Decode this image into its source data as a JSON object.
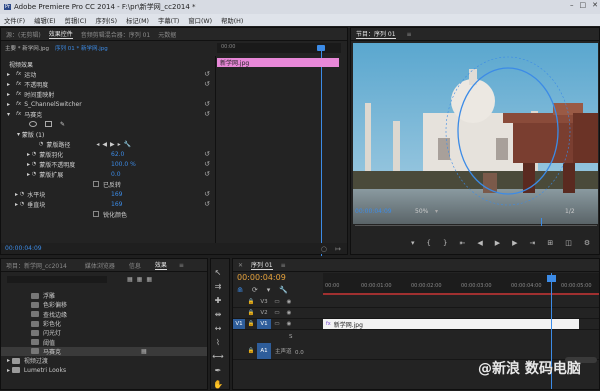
{
  "window": {
    "title": "Adobe Premiere Pro CC 2014 - F:\\pr\\新学网_cc2014 *",
    "logo_text": "Pr"
  },
  "menu": [
    "文件(F)",
    "编辑(E)",
    "剪辑(C)",
    "序列(S)",
    "标记(M)",
    "字幕(T)",
    "窗口(W)",
    "帮助(H)"
  ],
  "effect_controls": {
    "tabs": [
      "源：(无剪辑)",
      "效果控件",
      "音频剪辑混合器：序列 01",
      "元数据"
    ],
    "breadcrumb_master": "主要 * 新学网.jpg",
    "breadcrumb_seq": "序列 01 * 新学网.jpg",
    "section": "视频效果",
    "effects": [
      "运动",
      "不透明度",
      "时间重映射",
      "S_ChannelSwitcher",
      "马赛克"
    ],
    "mask_label": "蒙版 (1)",
    "mask_props": [
      {
        "name": "蒙版路径"
      },
      {
        "name": "蒙版羽化",
        "value": "62.0"
      },
      {
        "name": "蒙版不透明度",
        "value": "100.0 %"
      },
      {
        "name": "蒙版扩展",
        "value": "0.0"
      }
    ],
    "inverted_label": "已反转",
    "props": [
      {
        "name": "水平块",
        "value": "169"
      },
      {
        "name": "垂直块",
        "value": "169"
      }
    ],
    "sharp_label": "锐化颜色",
    "timecode": "00:00:04:09",
    "ruler_start": "00:00",
    "clip": "新学网.jpg"
  },
  "program": {
    "title": "节目：序列 01",
    "timecode": "00:00:04:09",
    "zoom": "50%",
    "fraction": "1/2"
  },
  "project": {
    "tabs": [
      "项目：新学网_cc2014",
      "媒体浏览器",
      "信息",
      "效果"
    ],
    "items": [
      "浮雕",
      "色彩偏移",
      "查找边缘",
      "彩色化",
      "闪光灯",
      "阈值",
      "马赛克"
    ],
    "folders": [
      "视频过渡",
      "Lumetri Looks"
    ]
  },
  "timeline": {
    "tab": "序列 01",
    "timecode": "00:00:04:09",
    "ruler": [
      "00:00",
      "00:00:01:00",
      "00:00:02:00",
      "00:00:03:00",
      "00:00:04:00",
      "00:00:05:00"
    ],
    "tracks": [
      {
        "src": "",
        "name": "V3"
      },
      {
        "src": "",
        "name": "V2"
      },
      {
        "src": "V1",
        "name": "V1"
      },
      {
        "src": "",
        "name": "A1"
      }
    ],
    "master": "主声道",
    "master_val": "0.0",
    "meter_label": "S",
    "clip": "新学网.jpg"
  },
  "watermark": "@新浪 数码电脑"
}
